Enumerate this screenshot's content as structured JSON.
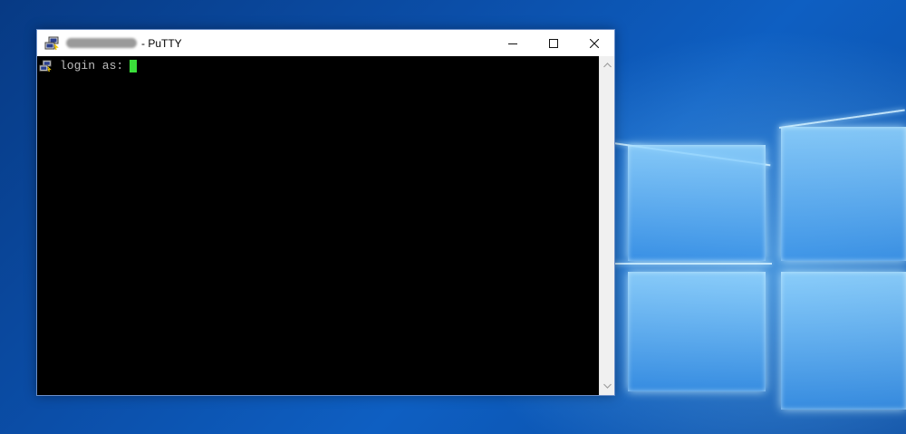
{
  "desktop": {
    "wallpaper": "windows-10-hero-logo"
  },
  "window": {
    "title_suffix": "- PuTTY",
    "icon": "putty-icon",
    "caption": {
      "minimize": "minimize-icon",
      "maximize": "maximize-icon",
      "close": "close-icon"
    }
  },
  "terminal": {
    "prompt": "login as:",
    "cursor_color": "#3adf3a",
    "background": "#000000",
    "text_color": "#bfbfbf"
  },
  "scrollbar": {
    "up": "arrow-up-icon",
    "down": "arrow-down-icon"
  }
}
